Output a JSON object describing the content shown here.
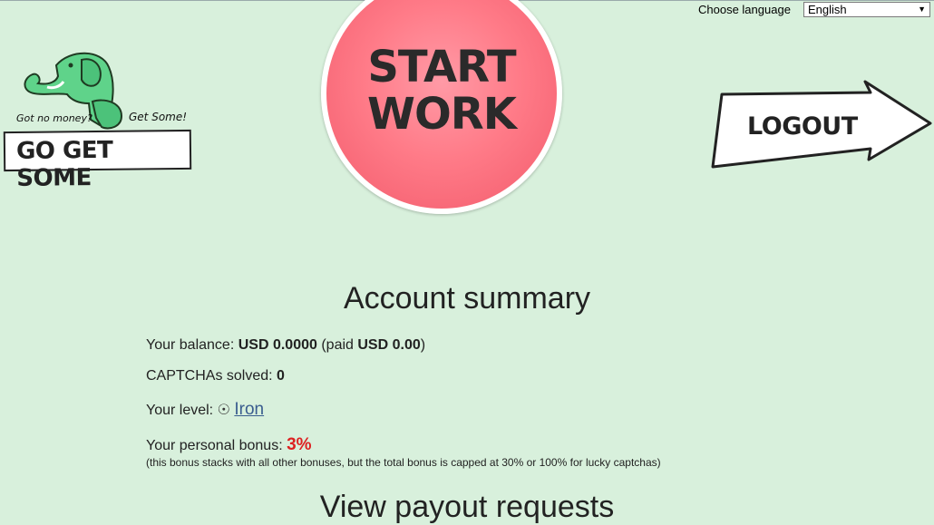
{
  "language": {
    "label": "Choose language",
    "selected": "English"
  },
  "logo": {
    "tag_left": "Got no money?",
    "tag_right": "Get Some!",
    "main": "GO GET SOME"
  },
  "start_button": {
    "line1": "START",
    "line2": "WORK"
  },
  "logout_button": {
    "label": "LOGOUT"
  },
  "summary": {
    "title": "Account summary",
    "balance_label": "Your balance:",
    "balance_value": "USD 0.0000",
    "paid_open": "(paid",
    "paid_value": "USD 0.00",
    "paid_close": ")",
    "captchas_label": "CAPTCHAs solved:",
    "captchas_value": "0",
    "level_label": "Your level:",
    "level_value": "Iron",
    "bonus_label": "Your personal bonus:",
    "bonus_value": "3%",
    "bonus_note": "(this bonus stacks with all other bonuses, but the total bonus is capped at 30% or 100% for lucky captchas)"
  },
  "payout": {
    "title": "View payout requests"
  },
  "colors": {
    "background": "#d8f0dc",
    "start": "#ff7b88",
    "bonus": "#dd2222",
    "link": "#3a5d8f"
  }
}
